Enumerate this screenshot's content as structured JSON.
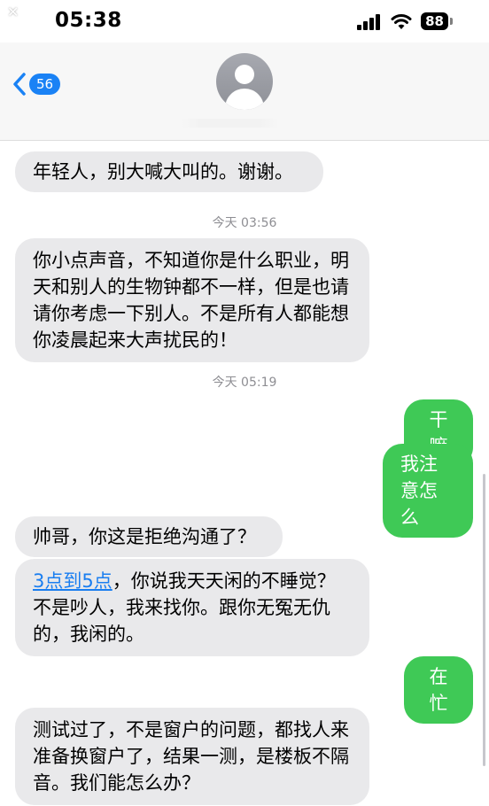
{
  "overlay": {
    "close_glyph": "✕"
  },
  "status_bar": {
    "time": "05:38",
    "battery": "88"
  },
  "header": {
    "back_count": "56",
    "contact_name": ""
  },
  "messages": [
    {
      "direction": "incoming",
      "text": "年轻人，别大喊大叫的。谢谢。"
    },
    {
      "direction": "timestamp",
      "text": "今天 03:56"
    },
    {
      "direction": "incoming",
      "text": "你小点声音，不知道你是什么职业，明天和别人的生物钟都不一样，但是也请请你考虑一下别人。不是所有人都能想你凌晨起来大声扰民的！"
    },
    {
      "direction": "timestamp",
      "text": "今天 05:19"
    },
    {
      "direction": "outgoing",
      "text": "干嘛"
    },
    {
      "direction": "outgoing",
      "text": "我注意怎么"
    },
    {
      "direction": "incoming",
      "text": "帅哥，你这是拒绝沟通了？"
    },
    {
      "direction": "incoming",
      "link": "3点到5点",
      "text": "，你说我天天闲的不睡觉？不是吵人，我来找你。跟你无冤无仇的，我闲的。"
    },
    {
      "direction": "outgoing",
      "text": "在忙"
    },
    {
      "direction": "incoming",
      "text": "测试过了，不是窗户的问题，都找人来准备换窗户了，结果一测，是楼板不隔音。我们能怎么办？"
    }
  ],
  "colors": {
    "incoming_bubble": "#e9e9eb",
    "outgoing_bubble": "#3fc956",
    "accent": "#1a82f5"
  }
}
